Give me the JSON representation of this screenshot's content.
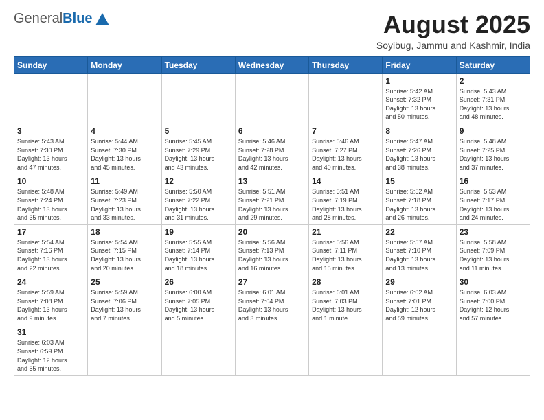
{
  "header": {
    "logo_general": "General",
    "logo_blue": "Blue",
    "month_year": "August 2025",
    "location": "Soyibug, Jammu and Kashmir, India"
  },
  "weekdays": [
    "Sunday",
    "Monday",
    "Tuesday",
    "Wednesday",
    "Thursday",
    "Friday",
    "Saturday"
  ],
  "weeks": [
    [
      {
        "day": null,
        "info": null
      },
      {
        "day": null,
        "info": null
      },
      {
        "day": null,
        "info": null
      },
      {
        "day": null,
        "info": null
      },
      {
        "day": null,
        "info": null
      },
      {
        "day": "1",
        "info": "Sunrise: 5:42 AM\nSunset: 7:32 PM\nDaylight: 13 hours\nand 50 minutes."
      },
      {
        "day": "2",
        "info": "Sunrise: 5:43 AM\nSunset: 7:31 PM\nDaylight: 13 hours\nand 48 minutes."
      }
    ],
    [
      {
        "day": "3",
        "info": "Sunrise: 5:43 AM\nSunset: 7:30 PM\nDaylight: 13 hours\nand 47 minutes."
      },
      {
        "day": "4",
        "info": "Sunrise: 5:44 AM\nSunset: 7:30 PM\nDaylight: 13 hours\nand 45 minutes."
      },
      {
        "day": "5",
        "info": "Sunrise: 5:45 AM\nSunset: 7:29 PM\nDaylight: 13 hours\nand 43 minutes."
      },
      {
        "day": "6",
        "info": "Sunrise: 5:46 AM\nSunset: 7:28 PM\nDaylight: 13 hours\nand 42 minutes."
      },
      {
        "day": "7",
        "info": "Sunrise: 5:46 AM\nSunset: 7:27 PM\nDaylight: 13 hours\nand 40 minutes."
      },
      {
        "day": "8",
        "info": "Sunrise: 5:47 AM\nSunset: 7:26 PM\nDaylight: 13 hours\nand 38 minutes."
      },
      {
        "day": "9",
        "info": "Sunrise: 5:48 AM\nSunset: 7:25 PM\nDaylight: 13 hours\nand 37 minutes."
      }
    ],
    [
      {
        "day": "10",
        "info": "Sunrise: 5:48 AM\nSunset: 7:24 PM\nDaylight: 13 hours\nand 35 minutes."
      },
      {
        "day": "11",
        "info": "Sunrise: 5:49 AM\nSunset: 7:23 PM\nDaylight: 13 hours\nand 33 minutes."
      },
      {
        "day": "12",
        "info": "Sunrise: 5:50 AM\nSunset: 7:22 PM\nDaylight: 13 hours\nand 31 minutes."
      },
      {
        "day": "13",
        "info": "Sunrise: 5:51 AM\nSunset: 7:21 PM\nDaylight: 13 hours\nand 29 minutes."
      },
      {
        "day": "14",
        "info": "Sunrise: 5:51 AM\nSunset: 7:19 PM\nDaylight: 13 hours\nand 28 minutes."
      },
      {
        "day": "15",
        "info": "Sunrise: 5:52 AM\nSunset: 7:18 PM\nDaylight: 13 hours\nand 26 minutes."
      },
      {
        "day": "16",
        "info": "Sunrise: 5:53 AM\nSunset: 7:17 PM\nDaylight: 13 hours\nand 24 minutes."
      }
    ],
    [
      {
        "day": "17",
        "info": "Sunrise: 5:54 AM\nSunset: 7:16 PM\nDaylight: 13 hours\nand 22 minutes."
      },
      {
        "day": "18",
        "info": "Sunrise: 5:54 AM\nSunset: 7:15 PM\nDaylight: 13 hours\nand 20 minutes."
      },
      {
        "day": "19",
        "info": "Sunrise: 5:55 AM\nSunset: 7:14 PM\nDaylight: 13 hours\nand 18 minutes."
      },
      {
        "day": "20",
        "info": "Sunrise: 5:56 AM\nSunset: 7:13 PM\nDaylight: 13 hours\nand 16 minutes."
      },
      {
        "day": "21",
        "info": "Sunrise: 5:56 AM\nSunset: 7:11 PM\nDaylight: 13 hours\nand 15 minutes."
      },
      {
        "day": "22",
        "info": "Sunrise: 5:57 AM\nSunset: 7:10 PM\nDaylight: 13 hours\nand 13 minutes."
      },
      {
        "day": "23",
        "info": "Sunrise: 5:58 AM\nSunset: 7:09 PM\nDaylight: 13 hours\nand 11 minutes."
      }
    ],
    [
      {
        "day": "24",
        "info": "Sunrise: 5:59 AM\nSunset: 7:08 PM\nDaylight: 13 hours\nand 9 minutes."
      },
      {
        "day": "25",
        "info": "Sunrise: 5:59 AM\nSunset: 7:06 PM\nDaylight: 13 hours\nand 7 minutes."
      },
      {
        "day": "26",
        "info": "Sunrise: 6:00 AM\nSunset: 7:05 PM\nDaylight: 13 hours\nand 5 minutes."
      },
      {
        "day": "27",
        "info": "Sunrise: 6:01 AM\nSunset: 7:04 PM\nDaylight: 13 hours\nand 3 minutes."
      },
      {
        "day": "28",
        "info": "Sunrise: 6:01 AM\nSunset: 7:03 PM\nDaylight: 13 hours\nand 1 minute."
      },
      {
        "day": "29",
        "info": "Sunrise: 6:02 AM\nSunset: 7:01 PM\nDaylight: 12 hours\nand 59 minutes."
      },
      {
        "day": "30",
        "info": "Sunrise: 6:03 AM\nSunset: 7:00 PM\nDaylight: 12 hours\nand 57 minutes."
      }
    ],
    [
      {
        "day": "31",
        "info": "Sunrise: 6:03 AM\nSunset: 6:59 PM\nDaylight: 12 hours\nand 55 minutes."
      },
      {
        "day": null,
        "info": null
      },
      {
        "day": null,
        "info": null
      },
      {
        "day": null,
        "info": null
      },
      {
        "day": null,
        "info": null
      },
      {
        "day": null,
        "info": null
      },
      {
        "day": null,
        "info": null
      }
    ]
  ]
}
